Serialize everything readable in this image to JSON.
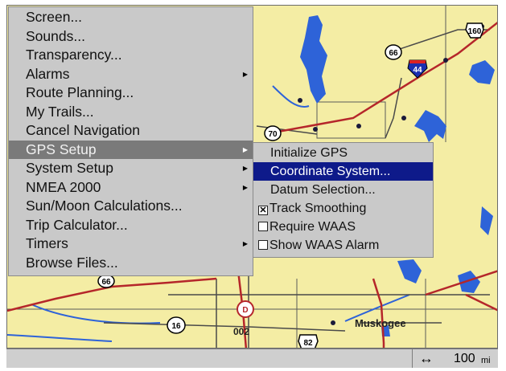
{
  "main_menu": {
    "items": [
      {
        "label": "Screen...",
        "submenu": false
      },
      {
        "label": "Sounds...",
        "submenu": false
      },
      {
        "label": "Transparency...",
        "submenu": false
      },
      {
        "label": "Alarms",
        "submenu": true
      },
      {
        "label": "Route Planning...",
        "submenu": false
      },
      {
        "label": "My Trails...",
        "submenu": false
      },
      {
        "label": "Cancel Navigation",
        "submenu": false
      },
      {
        "label": "GPS Setup",
        "submenu": true,
        "selected": true
      },
      {
        "label": "System Setup",
        "submenu": true
      },
      {
        "label": "NMEA 2000",
        "submenu": true
      },
      {
        "label": "Sun/Moon Calculations...",
        "submenu": false
      },
      {
        "label": "Trip Calculator...",
        "submenu": false
      },
      {
        "label": "Timers",
        "submenu": true
      },
      {
        "label": "Browse Files...",
        "submenu": false
      }
    ]
  },
  "gps_submenu": {
    "items": [
      {
        "label": "Initialize GPS",
        "type": "action"
      },
      {
        "label": "Coordinate System...",
        "type": "action",
        "selected": true
      },
      {
        "label": "Datum Selection...",
        "type": "action"
      },
      {
        "label": "Track Smoothing",
        "type": "checkbox",
        "checked": true
      },
      {
        "label": "Require WAAS",
        "type": "checkbox",
        "checked": false
      },
      {
        "label": "Show WAAS Alarm",
        "type": "checkbox",
        "checked": false
      }
    ]
  },
  "map": {
    "town_label": "Muskogee",
    "shields": {
      "us_160": "160",
      "hwy_66_top": "66",
      "interstate_44": "44",
      "hwy_70": "70",
      "hwy_66_bottom": "66",
      "hwy_16": "16",
      "hwy_d": "D",
      "hwy_82": "82",
      "road_002": "002"
    },
    "colors": {
      "land": "#f4eda4",
      "water": "#2e63d8",
      "highway": "#b5262a",
      "road": "#4a4a4a",
      "selection_submenu": "#0e1a8a",
      "selection_menu": "#7a7a7a",
      "menu_bg": "#c9c9c9"
    }
  },
  "status_bar": {
    "scale_arrow": "↔",
    "scale_value": "100",
    "scale_unit": "mi"
  }
}
